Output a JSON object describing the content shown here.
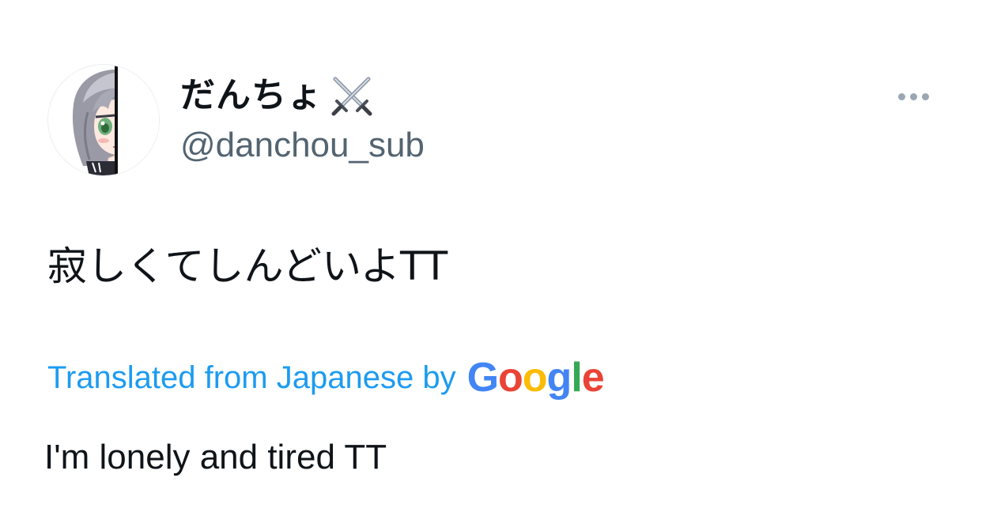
{
  "author": {
    "display_name": "だんちょ",
    "display_name_emoji_icon": "crossed-swords-icon",
    "handle": "@danchou_sub",
    "avatar_icon": "anime-girl-peeking-avatar"
  },
  "menu": {
    "more_icon": "more-horizontal-icon"
  },
  "tweet": {
    "text": "寂しくてしんどいよTT"
  },
  "translation": {
    "label": "Translated from Japanese by",
    "provider_letters": [
      "G",
      "o",
      "o",
      "g",
      "l",
      "e"
    ],
    "provider_colors": [
      "#4285F4",
      "#EA4335",
      "#FBBC05",
      "#4285F4",
      "#34A853",
      "#EA4335"
    ],
    "translated_text": "I'm lonely and tired TT"
  },
  "colors": {
    "text_primary": "#0f1419",
    "text_secondary": "#536471",
    "link_blue": "#1d9bf0",
    "more_dots": "#9aa7b3"
  }
}
